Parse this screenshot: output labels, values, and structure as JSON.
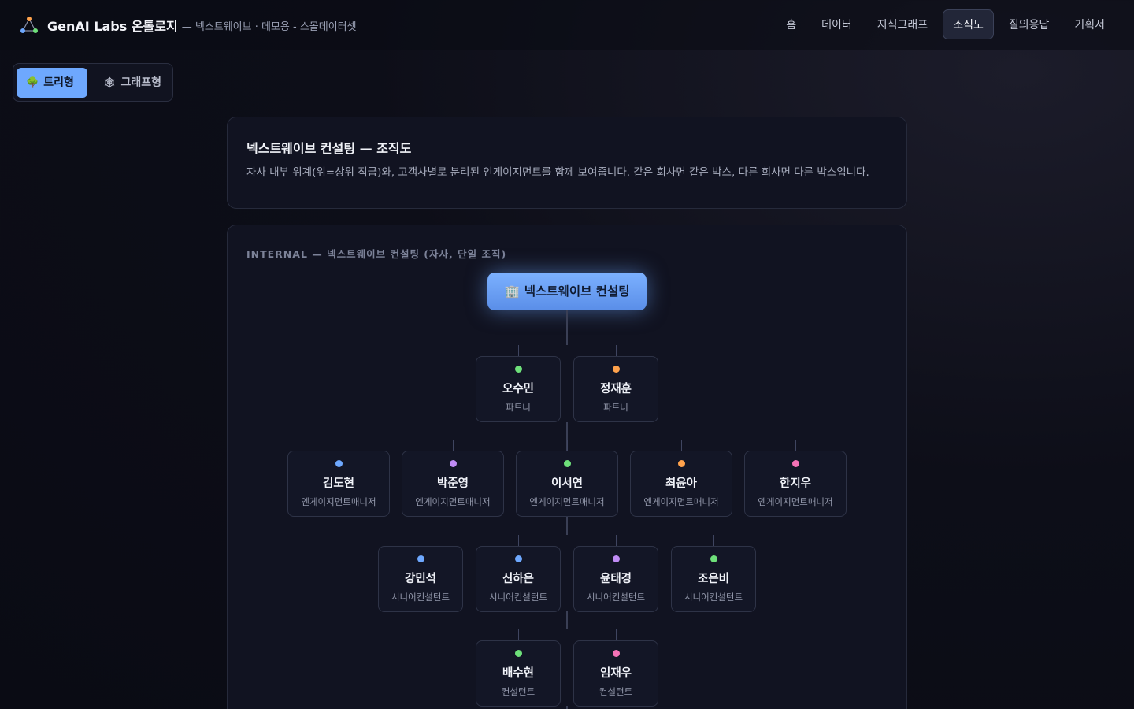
{
  "header": {
    "brand_name": "GenAI Labs 온톨로지",
    "brand_subtitle": "— 넥스트웨이브 · 데모용 - 스몰데이터셋",
    "nav": [
      {
        "label": "홈",
        "active": false
      },
      {
        "label": "데이터",
        "active": false
      },
      {
        "label": "지식그래프",
        "active": false
      },
      {
        "label": "조직도",
        "active": true
      },
      {
        "label": "질의응답",
        "active": false
      },
      {
        "label": "기획서",
        "active": false
      }
    ]
  },
  "view_toggle": {
    "tree_label": "트리형",
    "tree_icon": "🌳",
    "graph_label": "그래프형",
    "graph_icon": "🕸",
    "selected": "tree"
  },
  "intro": {
    "title": "넥스트웨이브 컨설팅 — 조직도",
    "description": "자사 내부 위계(위=상위 직급)와, 고객사별로 분리된 인게이지먼트를 함께 보여줍니다. 같은 회사면 같은 박스, 다른 회사면 다른 박스입니다."
  },
  "org": {
    "section_label": "INTERNAL — 넥스트웨이브 컨설팅 (자사, 단일 조직)",
    "root": {
      "label": "넥스트웨이브 컨설팅",
      "icon": "🏢"
    },
    "levels": [
      [
        {
          "name": "오수민",
          "role": "파트너",
          "dot": "#6ee07a"
        },
        {
          "name": "정재훈",
          "role": "파트너",
          "dot": "#ffa24c"
        }
      ],
      [
        {
          "name": "김도현",
          "role": "엔게이지먼트매니저",
          "dot": "#6ea8fe"
        },
        {
          "name": "박준영",
          "role": "엔게이지먼트매니저",
          "dot": "#c08cf5"
        },
        {
          "name": "이서연",
          "role": "엔게이지먼트매니저",
          "dot": "#6ee07a"
        },
        {
          "name": "최윤아",
          "role": "엔게이지먼트매니저",
          "dot": "#ffa24c"
        },
        {
          "name": "한지우",
          "role": "엔게이지먼트매니저",
          "dot": "#f472b6"
        }
      ],
      [
        {
          "name": "강민석",
          "role": "시니어컨설턴트",
          "dot": "#6ea8fe"
        },
        {
          "name": "신하은",
          "role": "시니어컨설턴트",
          "dot": "#6ea8fe"
        },
        {
          "name": "윤태경",
          "role": "시니어컨설턴트",
          "dot": "#c08cf5"
        },
        {
          "name": "조은비",
          "role": "시니어컨설턴트",
          "dot": "#6ee07a"
        }
      ],
      [
        {
          "name": "배수현",
          "role": "컨설턴트",
          "dot": "#6ee07a"
        },
        {
          "name": "임재우",
          "role": "컨설턴트",
          "dot": "#f472b6"
        }
      ]
    ]
  }
}
